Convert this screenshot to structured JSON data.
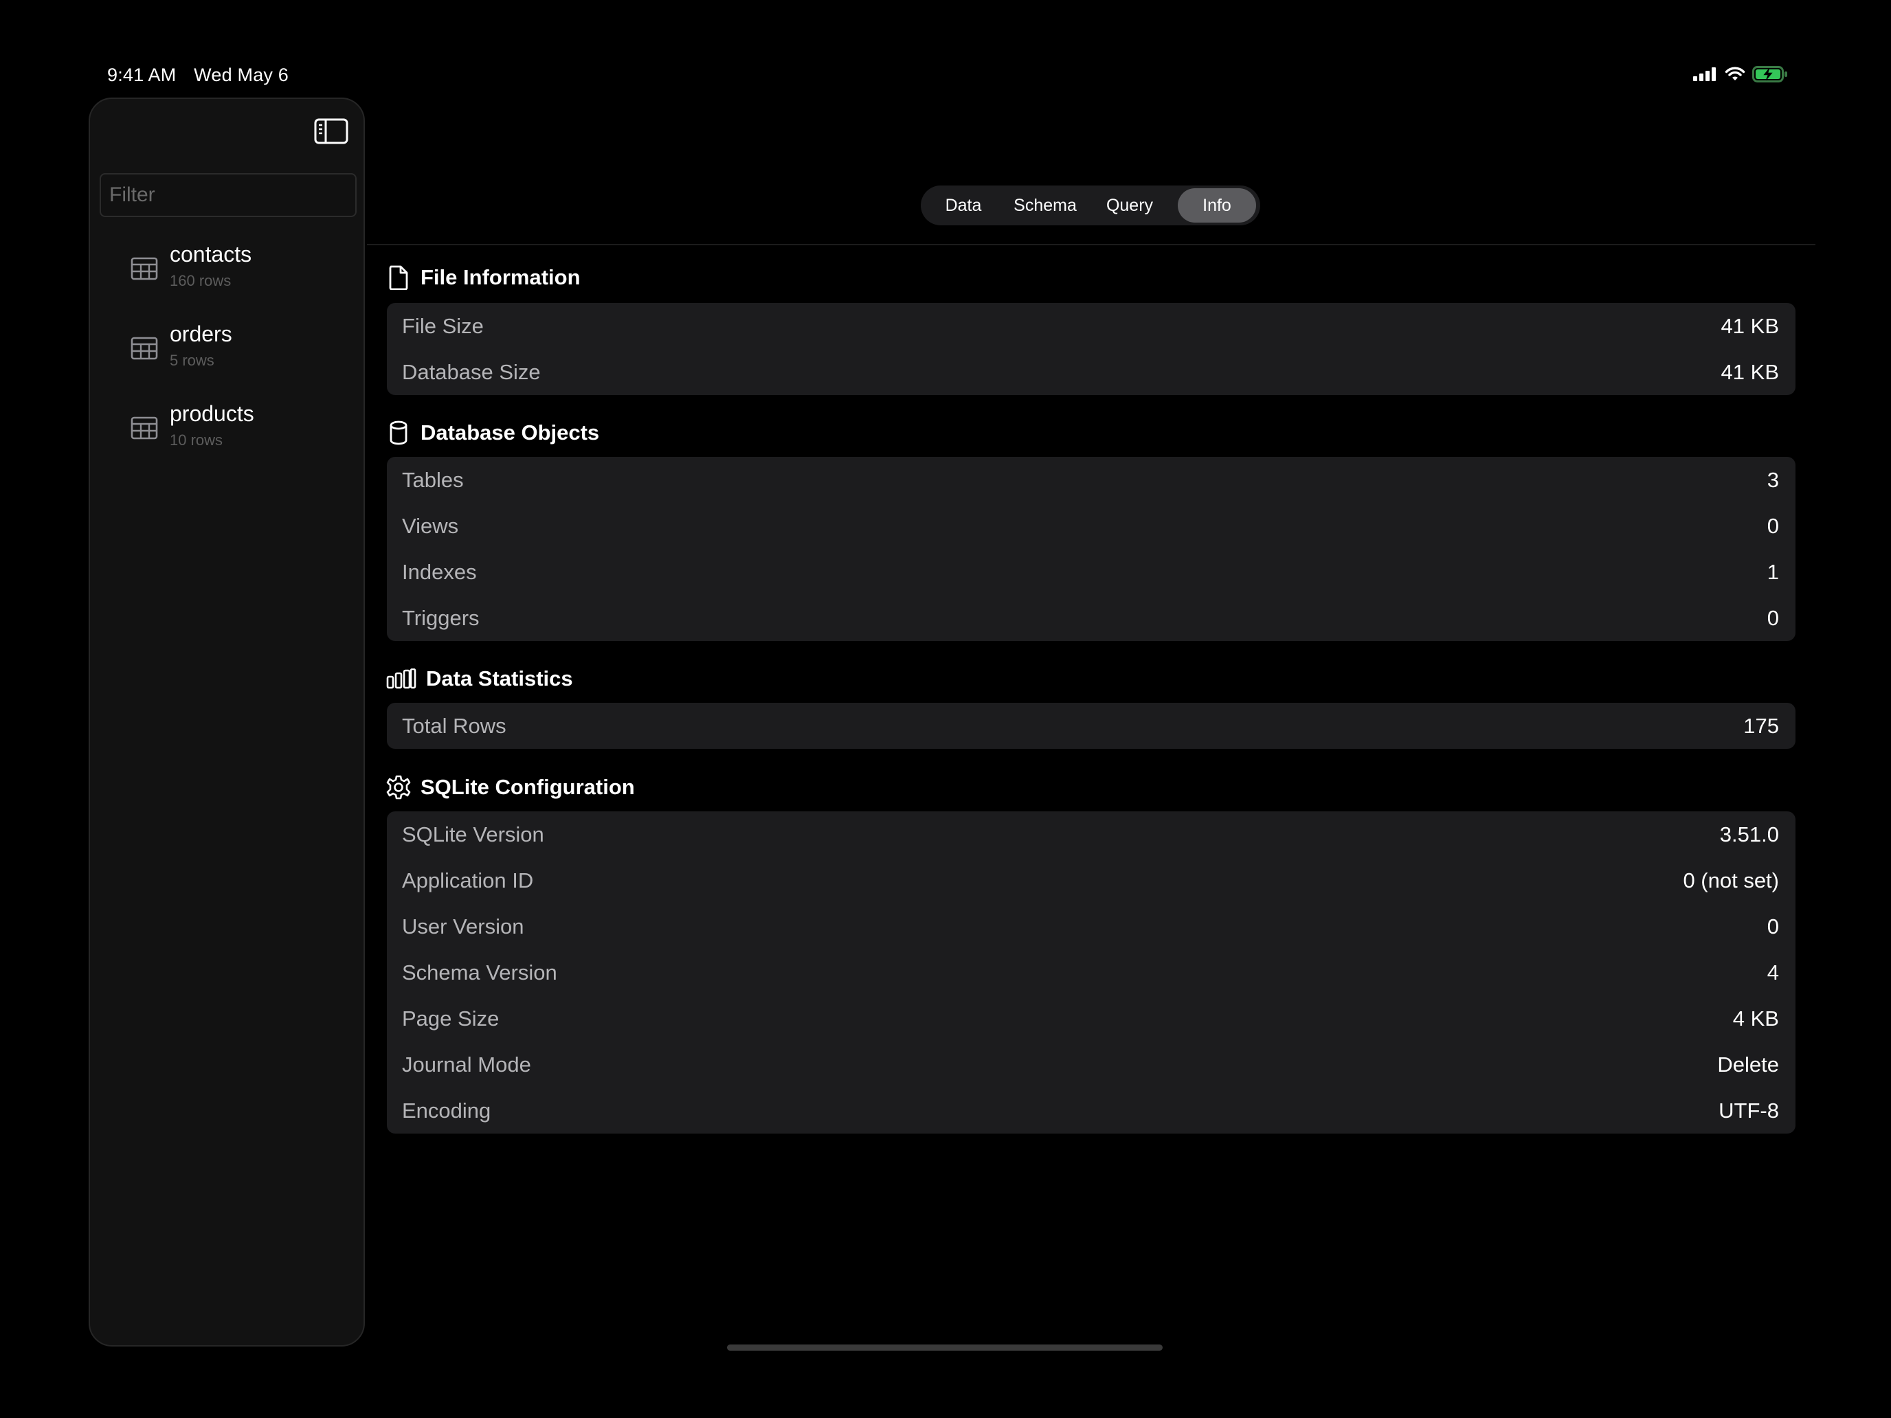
{
  "status_bar": {
    "time": "9:41 AM",
    "date": "Wed May 6",
    "icons": [
      "cellular-signal-icon",
      "wifi-icon",
      "battery-charging-icon"
    ],
    "battery_color": "#34c759"
  },
  "sidebar": {
    "toggle_icon": "sidebar-toggle-icon",
    "filter_placeholder": "Filter",
    "filter_value": "",
    "tables": [
      {
        "name": "contacts",
        "rows": "160 rows",
        "icon": "table-icon"
      },
      {
        "name": "orders",
        "rows": "5 rows",
        "icon": "table-icon"
      },
      {
        "name": "products",
        "rows": "10 rows",
        "icon": "table-icon"
      }
    ]
  },
  "tabs": {
    "items": [
      "Data",
      "Schema",
      "Query",
      "Info"
    ],
    "selected": "Info"
  },
  "sections": {
    "file_info": {
      "title": "File Information",
      "icon": "document-icon",
      "rows": [
        {
          "label": "File Size",
          "value": "41 KB"
        },
        {
          "label": "Database Size",
          "value": "41 KB"
        }
      ]
    },
    "db_objects": {
      "title": "Database Objects",
      "icon": "database-cylinder-icon",
      "rows": [
        {
          "label": "Tables",
          "value": "3"
        },
        {
          "label": "Views",
          "value": "0"
        },
        {
          "label": "Indexes",
          "value": "1"
        },
        {
          "label": "Triggers",
          "value": "0"
        }
      ]
    },
    "data_stats": {
      "title": "Data Statistics",
      "icon": "bar-chart-icon",
      "rows": [
        {
          "label": "Total Rows",
          "value": "175"
        }
      ]
    },
    "sqlite_config": {
      "title": "SQLite Configuration",
      "icon": "gear-icon",
      "rows": [
        {
          "label": "SQLite Version",
          "value": "3.51.0"
        },
        {
          "label": "Application ID",
          "value": "0 (not set)"
        },
        {
          "label": "User Version",
          "value": "0"
        },
        {
          "label": "Schema Version",
          "value": "4"
        },
        {
          "label": "Page Size",
          "value": "4 KB"
        },
        {
          "label": "Journal Mode",
          "value": "Delete"
        },
        {
          "label": "Encoding",
          "value": "UTF-8"
        }
      ]
    }
  }
}
